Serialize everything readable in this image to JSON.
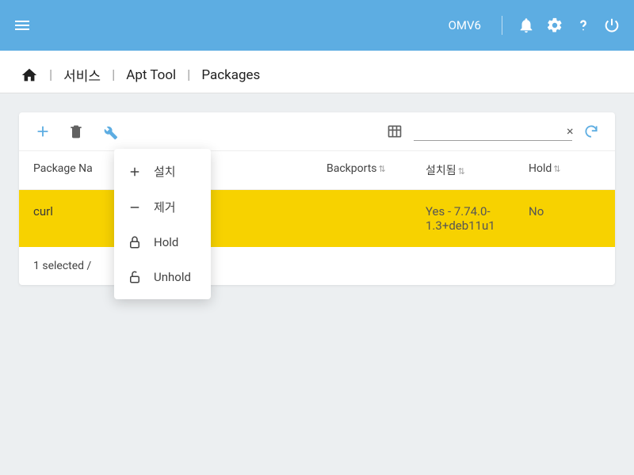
{
  "header": {
    "brand": "OMV6"
  },
  "breadcrumb": {
    "items": [
      "서비스",
      "Apt Tool",
      "Packages"
    ]
  },
  "toolbar": {
    "search_placeholder": ""
  },
  "columns": {
    "name": "Package Na",
    "backports": "Backports",
    "installed": "설치됨",
    "hold": "Hold"
  },
  "rows": [
    {
      "name": "curl",
      "backports": "",
      "installed": "Yes - 7.74.0-1.3+deb11u1",
      "hold": "No"
    }
  ],
  "footer": {
    "status": "1 selected /"
  },
  "menu": {
    "install": "설치",
    "remove": "제거",
    "hold": "Hold",
    "unhold": "Unhold"
  }
}
